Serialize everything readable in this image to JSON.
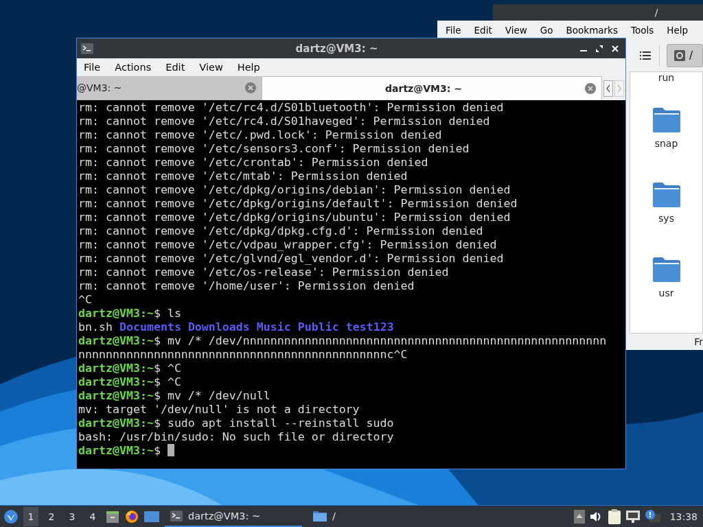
{
  "file_manager": {
    "title": "/",
    "menu": [
      "File",
      "Edit",
      "View",
      "Go",
      "Bookmarks",
      "Tools",
      "Help"
    ],
    "path_button": "/",
    "items": [
      {
        "name": "run"
      },
      {
        "name": "snap"
      },
      {
        "name": "sys"
      },
      {
        "name": "usr"
      }
    ],
    "status": "Fr"
  },
  "terminal": {
    "title": "dartz@VM3: ~",
    "menu": [
      "File",
      "Actions",
      "Edit",
      "View",
      "Help"
    ],
    "tabs": [
      {
        "label": "@VM3: ~",
        "selected": false
      },
      {
        "label": "dartz@VM3: ~",
        "selected": true
      }
    ],
    "lines": [
      {
        "kind": "output",
        "text": "rm: cannot remove '/etc/rc4.d/S01bluetooth': Permission denied"
      },
      {
        "kind": "output",
        "text": "rm: cannot remove '/etc/rc4.d/S01haveged': Permission denied"
      },
      {
        "kind": "output",
        "text": "rm: cannot remove '/etc/.pwd.lock': Permission denied"
      },
      {
        "kind": "output",
        "text": "rm: cannot remove '/etc/sensors3.conf': Permission denied"
      },
      {
        "kind": "output",
        "text": "rm: cannot remove '/etc/crontab': Permission denied"
      },
      {
        "kind": "output",
        "text": "rm: cannot remove '/etc/mtab': Permission denied"
      },
      {
        "kind": "output",
        "text": "rm: cannot remove '/etc/dpkg/origins/debian': Permission denied"
      },
      {
        "kind": "output",
        "text": "rm: cannot remove '/etc/dpkg/origins/default': Permission denied"
      },
      {
        "kind": "output",
        "text": "rm: cannot remove '/etc/dpkg/origins/ubuntu': Permission denied"
      },
      {
        "kind": "output",
        "text": "rm: cannot remove '/etc/dpkg/dpkg.cfg.d': Permission denied"
      },
      {
        "kind": "output",
        "text": "rm: cannot remove '/etc/vdpau_wrapper.cfg': Permission denied"
      },
      {
        "kind": "output",
        "text": "rm: cannot remove '/etc/glvnd/egl_vendor.d': Permission denied"
      },
      {
        "kind": "output",
        "text": "rm: cannot remove '/etc/os-release': Permission denied"
      },
      {
        "kind": "output",
        "text": "rm: cannot remove '/home/user': Permission denied"
      },
      {
        "kind": "output",
        "text": "^C"
      },
      {
        "kind": "prompt",
        "prompt": "dartz@VM3:~",
        "symbol": "$",
        "command": "ls"
      },
      {
        "kind": "listing",
        "items": [
          {
            "name": "bn.sh",
            "kind": "file"
          },
          {
            "name": "Documents",
            "kind": "dir"
          },
          {
            "name": "Downloads",
            "kind": "dir"
          },
          {
            "name": "Music",
            "kind": "dir"
          },
          {
            "name": "Public",
            "kind": "dir"
          },
          {
            "name": "test123",
            "kind": "dir"
          }
        ]
      },
      {
        "kind": "prompt",
        "prompt": "dartz@VM3:~",
        "symbol": "$",
        "command": "mv /* /dev/nnnnnnnnnnnnnnnnnnnnnnnnnnnnnnnnnnnnnnnnnnnnnnnnnnnnn"
      },
      {
        "kind": "output",
        "text": "nnnnnnnnnnnnnnnnnnnnnnnnnnnnnnnnnnnnnnnnnnnnnc^C"
      },
      {
        "kind": "prompt",
        "prompt": "dartz@VM3:~",
        "symbol": "$",
        "command": "^C"
      },
      {
        "kind": "prompt",
        "prompt": "dartz@VM3:~",
        "symbol": "$",
        "command": "^C"
      },
      {
        "kind": "prompt",
        "prompt": "dartz@VM3:~",
        "symbol": "$",
        "command": "mv /* /dev/null"
      },
      {
        "kind": "output",
        "text": "mv: target '/dev/null' is not a directory"
      },
      {
        "kind": "prompt",
        "prompt": "dartz@VM3:~",
        "symbol": "$",
        "command": "sudo apt install --reinstall sudo"
      },
      {
        "kind": "output",
        "text": "bash: /usr/bin/sudo: No such file or directory"
      },
      {
        "kind": "prompt",
        "prompt": "dartz@VM3:~",
        "symbol": "$",
        "cursor": true
      }
    ]
  },
  "taskbar": {
    "workspaces": [
      {
        "label": "1",
        "selected": true
      },
      {
        "label": "2",
        "selected": false
      },
      {
        "label": "3",
        "selected": false
      },
      {
        "label": "4",
        "selected": false
      }
    ],
    "tasks": [
      {
        "label": "dartz@VM3: ~",
        "kind": "terminal",
        "selected": true
      },
      {
        "label": "/",
        "kind": "folder",
        "selected": false
      }
    ],
    "clock": "13:38"
  }
}
